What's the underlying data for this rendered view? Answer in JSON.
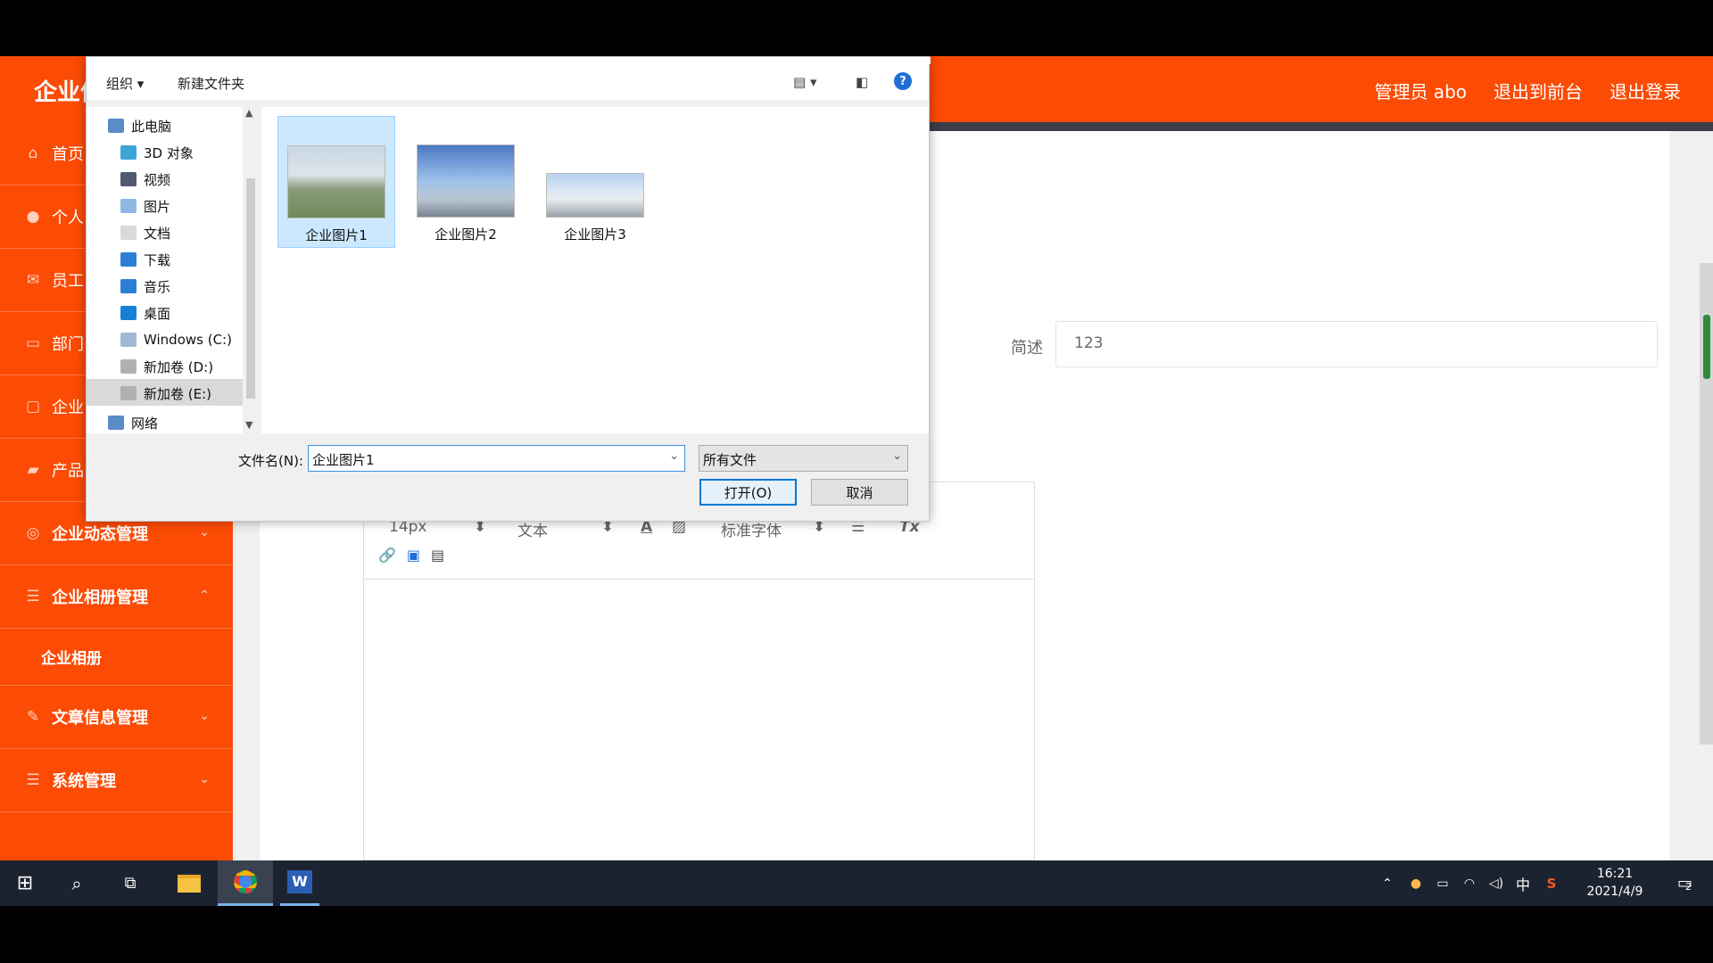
{
  "app": {
    "logo": "企业信",
    "header_links": [
      "管理员 abo",
      "退出到前台",
      "退出登录"
    ],
    "sidebar": {
      "items": [
        {
          "label": "首页",
          "icon": "home-icon"
        },
        {
          "label": "个人",
          "icon": "user-icon"
        },
        {
          "label": "员工",
          "icon": "mail-icon"
        },
        {
          "label": "部门",
          "icon": "card-icon"
        },
        {
          "label": "企业",
          "icon": "chat-icon"
        },
        {
          "label": "产品",
          "icon": "box-icon"
        },
        {
          "label": "企业动态管理",
          "icon": "target-icon"
        },
        {
          "label": "企业相册管理",
          "icon": "list-icon"
        },
        {
          "label": "文章信息管理",
          "icon": "pen-icon"
        },
        {
          "label": "系统管理",
          "icon": "list-icon"
        }
      ],
      "subitem": "企业相册"
    },
    "form": {
      "desc_label": "简述",
      "desc_value": "123"
    },
    "editor": {
      "font_size": "14px",
      "text_type": "文本",
      "font_family": "标准字体"
    },
    "colors": {
      "brand": "#fc4b05",
      "dark_strip": "#3b3e4a"
    }
  },
  "dialog": {
    "toolbar": {
      "organize": "组织",
      "new_folder": "新建文件夹"
    },
    "nav": [
      {
        "label": "此电脑",
        "icon": "computer-icon"
      },
      {
        "label": "3D 对象",
        "icon": "cube-icon"
      },
      {
        "label": "视频",
        "icon": "video-icon"
      },
      {
        "label": "图片",
        "icon": "picture-icon"
      },
      {
        "label": "文档",
        "icon": "document-icon"
      },
      {
        "label": "下载",
        "icon": "download-icon"
      },
      {
        "label": "音乐",
        "icon": "music-icon"
      },
      {
        "label": "桌面",
        "icon": "desktop-icon"
      },
      {
        "label": "Windows (C:)",
        "icon": "drive-icon"
      },
      {
        "label": "新加卷 (D:)",
        "icon": "drive-icon"
      },
      {
        "label": "新加卷 (E:)",
        "icon": "drive-icon"
      },
      {
        "label": "网络",
        "icon": "network-icon"
      }
    ],
    "files": [
      {
        "name": "企业图片1",
        "selected": true
      },
      {
        "name": "企业图片2",
        "selected": false
      },
      {
        "name": "企业图片3",
        "selected": false
      }
    ],
    "filename_label": "文件名(N):",
    "filename_value": "企业图片1",
    "filetype_value": "所有文件",
    "open_button": "打开(O)",
    "cancel_button": "取消"
  },
  "taskbar": {
    "time": "16:21",
    "date": "2021/4/9",
    "ime_lang": "中",
    "notification_count": "2",
    "ime_bar": [
      "中",
      "°,"
    ]
  }
}
